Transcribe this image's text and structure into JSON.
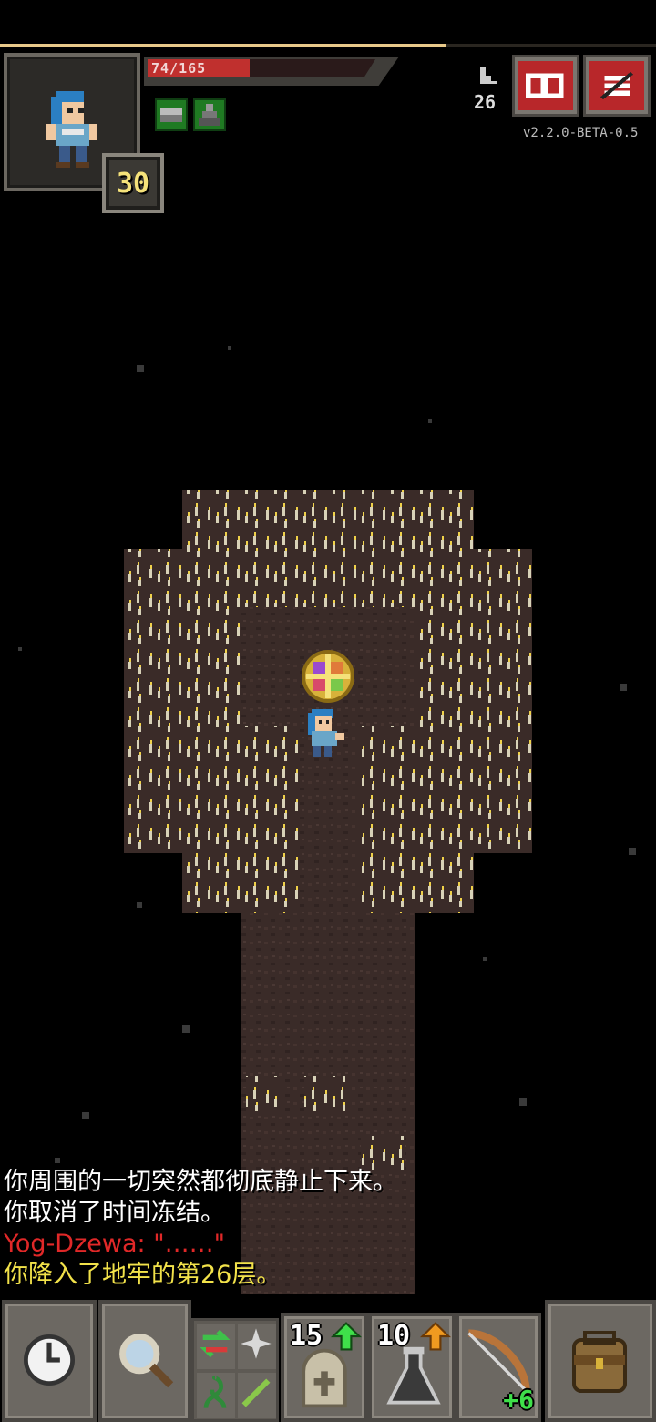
{
  "status": {
    "hp_text": "74/165",
    "hp_current": 74,
    "hp_max": 165,
    "xp_fraction": 0.68,
    "level": "30",
    "depth": "26",
    "version": "v2.2.0-BETA-0.5",
    "buffs": [
      "buff-icon",
      "buff-icon"
    ]
  },
  "buttons": {
    "journal_icon": "journal-icon",
    "menu_icon": "menu-icon"
  },
  "log": {
    "lines": [
      {
        "text": "你周围的一切突然都彻底静止下来。",
        "color": "#ffffff"
      },
      {
        "text": "你取消了时间冻结。",
        "color": "#ffffff"
      },
      {
        "text": "Yog-Dzewa: \"……\"",
        "color": "#e02828"
      },
      {
        "text": "你降入了地牢的第26层。",
        "color": "#f2e24a"
      }
    ]
  },
  "toolbar": {
    "wait_icon": "clock-icon",
    "search_icon": "magnifier-icon",
    "quickslots": [
      {
        "qty": "15",
        "icon": "tombstone-icon",
        "badge": "up-arrow-icon"
      },
      {
        "qty": "10",
        "icon": "flask-icon",
        "badge": "up-arrow-icon"
      },
      {
        "enchant": "+6",
        "icon": "bow-icon"
      }
    ],
    "backpack_icon": "backpack-icon"
  },
  "colors": {
    "hp": "#c0302e",
    "frame": "#6b6760",
    "floor": "#3a2b28",
    "candle_glow": "#f0d24a"
  }
}
